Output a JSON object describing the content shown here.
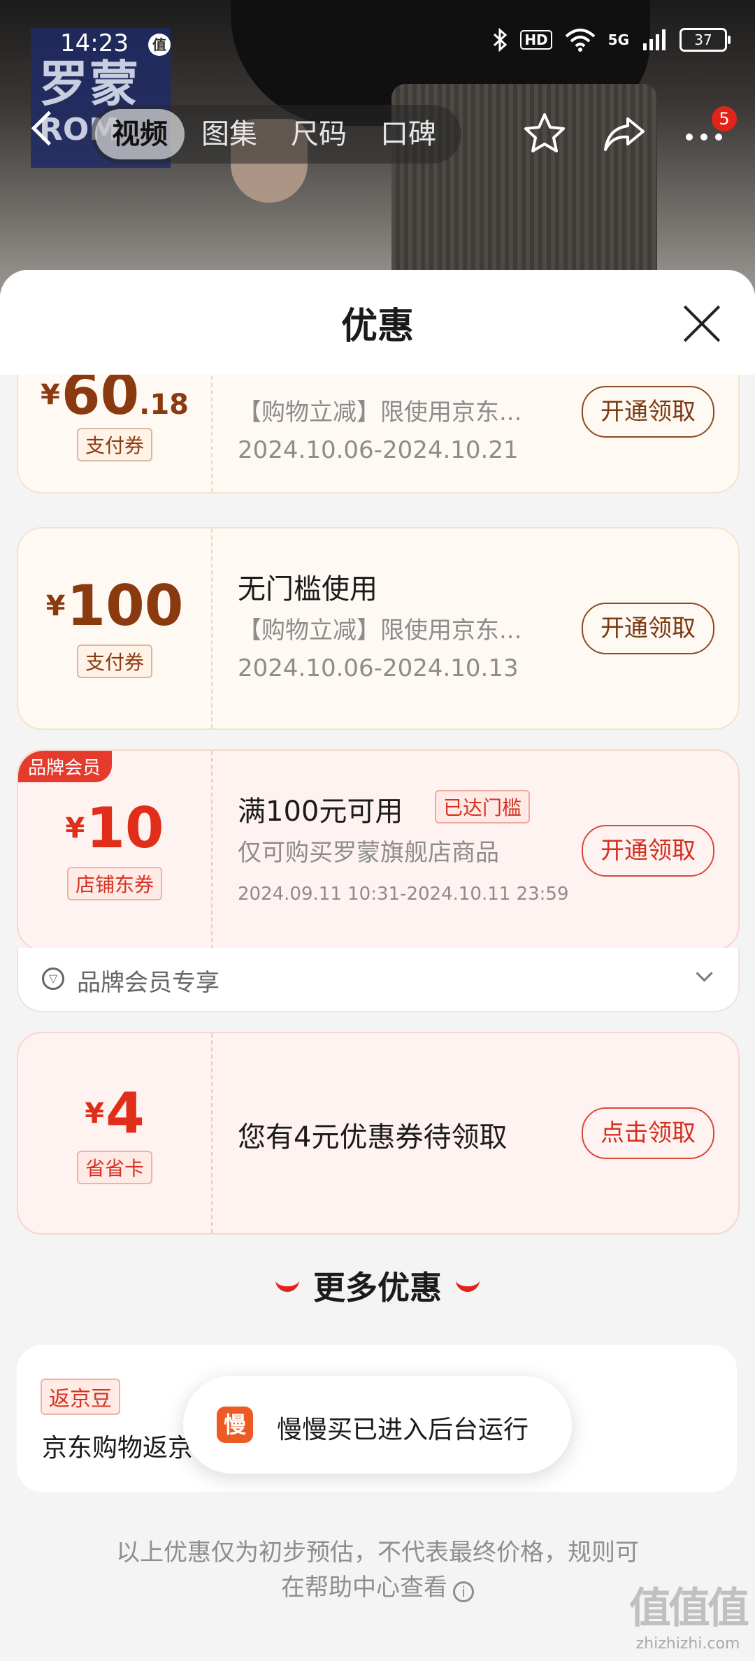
{
  "status_bar": {
    "time": "14:23",
    "badge": "值",
    "network": "5G",
    "hd": "HD",
    "battery": "37"
  },
  "header": {
    "brand_logo": "罗蒙",
    "brand_logo_sub": "ROM",
    "tabs": [
      {
        "label": "视频",
        "active": true
      },
      {
        "label": "图集",
        "active": false
      },
      {
        "label": "尺码",
        "active": false
      },
      {
        "label": "口碑",
        "active": false
      }
    ],
    "more_badge": "5"
  },
  "sheet": {
    "title": "优惠"
  },
  "coupons": [
    {
      "type": "pay",
      "currency": "¥",
      "amount": "60",
      "amount_decimal": ".18",
      "tag": "支付券",
      "desc": "【购物立减】限使用京东...",
      "date": "2024.10.06-2024.10.21",
      "button": "开通领取"
    },
    {
      "type": "pay",
      "currency": "¥",
      "amount": "100",
      "tag": "支付券",
      "title": "无门槛使用",
      "desc": "【购物立减】限使用京东...",
      "date": "2024.10.06-2024.10.13",
      "button": "开通领取"
    },
    {
      "type": "shop",
      "corner": "品牌会员",
      "currency": "¥",
      "amount": "10",
      "tag": "店铺东券",
      "title": "满100元可用",
      "reached": "已达门槛",
      "desc": "仅可购买罗蒙旗舰店商品",
      "date": "2024.09.11 10:31-2024.10.11 23:59",
      "button": "开通领取",
      "footer": "品牌会员专享"
    },
    {
      "type": "shop",
      "currency": "¥",
      "amount": "4",
      "tag": "省省卡",
      "title": "您有4元优惠券待领取",
      "button": "点击领取"
    }
  ],
  "more": {
    "title": "更多优惠",
    "rebate_tag": "返京豆",
    "rebate_text": "京东购物返京"
  },
  "toast": {
    "icon_text": "慢",
    "text": "慢慢买已进入后台运行"
  },
  "disclaimer": {
    "line1": "以上优惠仅为初步预估，不代表最终价格，规则可",
    "line2": "在帮助中心查看"
  },
  "watermark": {
    "logo": "值值值",
    "url": "zhizhizhi.com"
  },
  "colors": {
    "accent_red": "#e2231a",
    "pay_brown": "#8b3a10",
    "shop_red": "#e02e1a"
  }
}
